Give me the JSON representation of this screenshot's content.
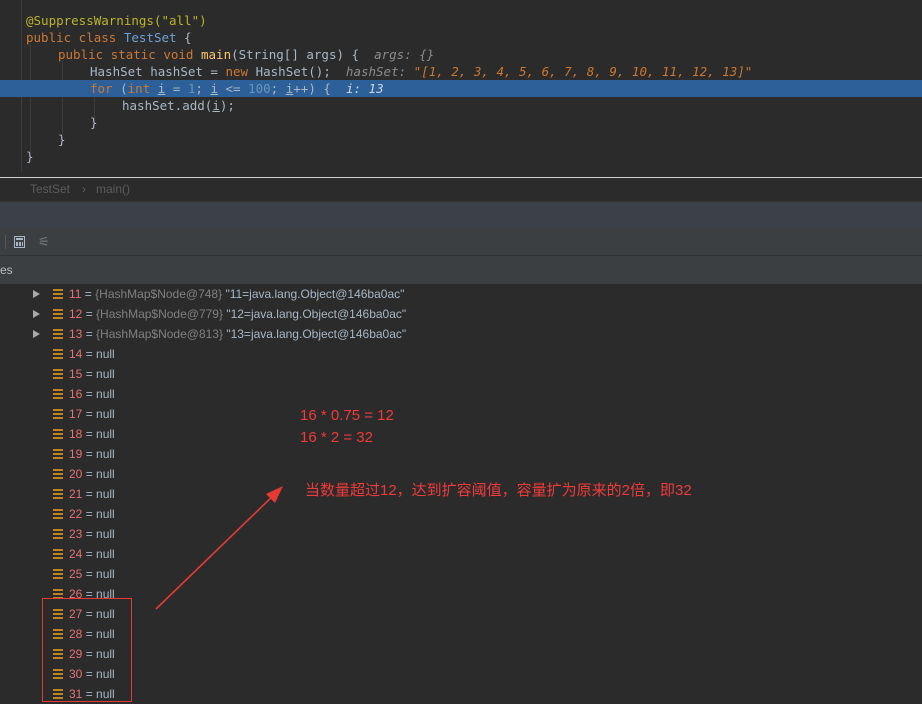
{
  "editor": {
    "lines": {
      "annotation": "@SuppressWarnings(\"all\")",
      "class_kw": "public class ",
      "class_name": "TestSet",
      "class_brace": " {",
      "main_kw": "public static void ",
      "main_name": "main",
      "main_params": "(String[] args) {",
      "main_hint": "args: {}",
      "hs_decl_type": "HashSet",
      "hs_decl_var": " hashSet = ",
      "hs_new": "new ",
      "hs_ctor": "HashSet",
      "hs_end": "();",
      "hs_hint_label": "hashSet:",
      "hs_hint_value": "\"[1, 2, 3, 4, 5, 6, 7, 8, 9, 10, 11, 12, 13]\"",
      "for_kw": "for ",
      "for_open": "(",
      "for_int": "int ",
      "for_i1": "i",
      "for_eq": " = ",
      "for_one": "1",
      "for_semi1": "; ",
      "for_i2": "i",
      "for_lt": " <= ",
      "for_hundred": "100",
      "for_semi2": "; ",
      "for_i3": "i",
      "for_inc": "++) {",
      "for_hint": "i: 13",
      "add_obj": "hashSet.",
      "add_fn": "add",
      "add_open": "(",
      "add_i": "i",
      "add_close": ");",
      "close_inner": "}",
      "close_method": "}",
      "close_class": "}"
    }
  },
  "breadcrumb": {
    "class": "TestSet",
    "sep": "›",
    "method": "main()"
  },
  "panel": {
    "tab_label": "es"
  },
  "variables": [
    {
      "index": "11",
      "object": "{HashMap$Node@748}",
      "value": "\"11=java.lang.Object@146ba0ac\"",
      "expandable": true
    },
    {
      "index": "12",
      "object": "{HashMap$Node@779}",
      "value": "\"12=java.lang.Object@146ba0ac\"",
      "expandable": true
    },
    {
      "index": "13",
      "object": "{HashMap$Node@813}",
      "value": "\"13=java.lang.Object@146ba0ac\"",
      "expandable": true
    },
    {
      "index": "14",
      "value": "null"
    },
    {
      "index": "15",
      "value": "null"
    },
    {
      "index": "16",
      "value": "null"
    },
    {
      "index": "17",
      "value": "null"
    },
    {
      "index": "18",
      "value": "null"
    },
    {
      "index": "19",
      "value": "null"
    },
    {
      "index": "20",
      "value": "null"
    },
    {
      "index": "21",
      "value": "null"
    },
    {
      "index": "22",
      "value": "null"
    },
    {
      "index": "23",
      "value": "null"
    },
    {
      "index": "24",
      "value": "null"
    },
    {
      "index": "25",
      "value": "null"
    },
    {
      "index": "26",
      "value": "null"
    },
    {
      "index": "27",
      "value": "null"
    },
    {
      "index": "28",
      "value": "null"
    },
    {
      "index": "29",
      "value": "null"
    },
    {
      "index": "30",
      "value": "null"
    },
    {
      "index": "31",
      "value": "null"
    }
  ],
  "annotations": {
    "calc_line1": "16 * 0.75 = 12",
    "calc_line2": "16 * 2 = 32",
    "explanation": "当数量超过12，达到扩容阈值，容量扩为原来的2倍，即32"
  },
  "icons": {
    "breakpoint": "breakpoint-icon",
    "execution": "execution-point-icon",
    "calculator": "evaluate-expression-icon",
    "settings": "settings-icon",
    "field": "field-icon",
    "expand": "expand-triangle-icon"
  },
  "colors": {
    "background": "#2b2b2b",
    "current_line": "#2d6099",
    "index": "#e57373",
    "annotation_red": "#ef3b3b"
  }
}
